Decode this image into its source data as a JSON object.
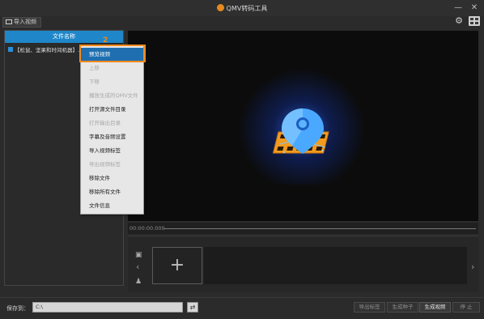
{
  "app": {
    "title": "QMV转码工具",
    "minimize": "—",
    "close": "✕"
  },
  "toolbar": {
    "import_label": "导入视频",
    "settings_icon": "gear-icon",
    "view_icon": "grid-view-icon"
  },
  "files": {
    "header": "文件名称",
    "rows": [
      {
        "name": "【松鼠、坚果和时间机器】.wmv"
      }
    ]
  },
  "context_menu": {
    "step_number": "2",
    "items": [
      {
        "label": "预览视频",
        "disabled": false,
        "highlighted": true
      },
      {
        "label": "上移",
        "disabled": true
      },
      {
        "label": "下移",
        "disabled": true
      },
      {
        "label": "播放生成的QMV文件",
        "disabled": true
      },
      {
        "label": "打开源文件目录",
        "disabled": false
      },
      {
        "label": "打开输出目录",
        "disabled": true
      },
      {
        "label": "字幕及音频设置",
        "disabled": false
      },
      {
        "label": "导入视频标签",
        "disabled": false
      },
      {
        "label": "导出视频标签",
        "disabled": true
      },
      {
        "label": "移除文件",
        "disabled": false
      },
      {
        "label": "移除所有文件",
        "disabled": false
      },
      {
        "label": "文件信息",
        "disabled": false
      }
    ]
  },
  "player": {
    "timecode": "00:00:00.000"
  },
  "clips": {
    "add_symbol": "+",
    "prev": "‹",
    "next": "›"
  },
  "bottom": {
    "save_to_label": "保存到：",
    "save_path": "C:\\",
    "buttons": {
      "export_tags": "导出标签",
      "make_seed": "生成种子",
      "make_video": "生成视频",
      "stop": "停 止"
    }
  },
  "colors": {
    "accent_blue": "#1f87c9",
    "highlight_orange": "#f28a1c",
    "logo_orange": "#e58a1f"
  }
}
